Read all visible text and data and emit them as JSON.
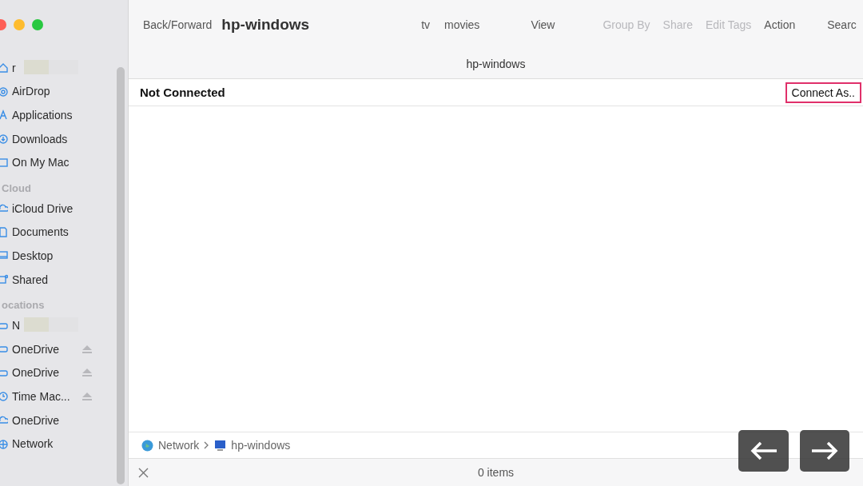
{
  "sidebar": {
    "sections": [
      {
        "items": [
          {
            "label": "r",
            "redacted": true
          },
          {
            "label": "AirDrop"
          },
          {
            "label": "Applications"
          },
          {
            "label": "Downloads"
          },
          {
            "label": "On My Mac"
          }
        ]
      },
      {
        "title": "Cloud",
        "items": [
          {
            "label": "iCloud Drive"
          },
          {
            "label": "Documents"
          },
          {
            "label": "Desktop"
          },
          {
            "label": "Shared"
          }
        ]
      },
      {
        "title": "ocations",
        "items": [
          {
            "label": "N",
            "redacted": true
          },
          {
            "label": "OneDrive",
            "eject": true
          },
          {
            "label": "OneDrive",
            "eject": true
          },
          {
            "label": "Time Mac...",
            "eject": true
          },
          {
            "label": "OneDrive"
          },
          {
            "label": "Network"
          }
        ]
      }
    ]
  },
  "toolbar": {
    "back_forward": "Back/Forward",
    "title": "hp-windows",
    "items": [
      {
        "label": "tv",
        "disabled": false
      },
      {
        "label": "movies",
        "disabled": false
      },
      {
        "label": "View",
        "disabled": false
      },
      {
        "label": "Group By",
        "disabled": true
      },
      {
        "label": "Share",
        "disabled": true
      },
      {
        "label": "Edit Tags",
        "disabled": true
      },
      {
        "label": "Action",
        "disabled": false
      },
      {
        "label": "Searc",
        "disabled": false
      }
    ]
  },
  "column_header": "hp-windows",
  "connection": {
    "status": "Not Connected",
    "button": "Connect As..",
    "highlighted": true
  },
  "path_bar": [
    "Network",
    "hp-windows"
  ],
  "status_bar": "0 items"
}
